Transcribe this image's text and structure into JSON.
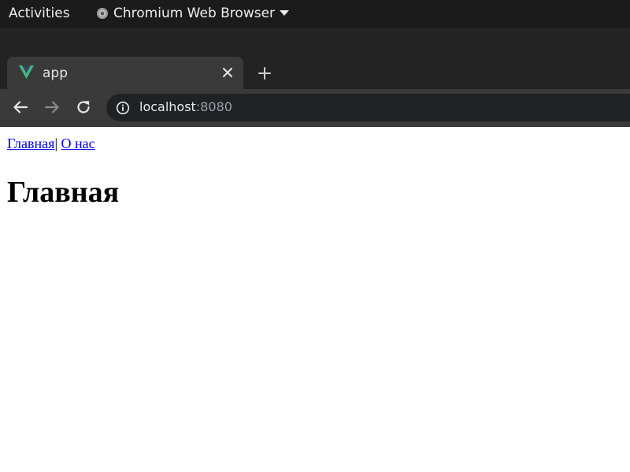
{
  "system_bar": {
    "activities_label": "Activities",
    "app_menu_label": "Chromium Web Browser"
  },
  "browser": {
    "tab": {
      "title": "app",
      "favicon": "vue-logo-icon"
    },
    "address_bar": {
      "host": "localhost",
      "port": ":8080"
    },
    "colors": {
      "vue_green": "#41b883",
      "vue_dark": "#35495e"
    }
  },
  "page": {
    "nav": {
      "home_link": "Главная",
      "separator": "|",
      "about_link": "О нас"
    },
    "heading": "Главная"
  }
}
